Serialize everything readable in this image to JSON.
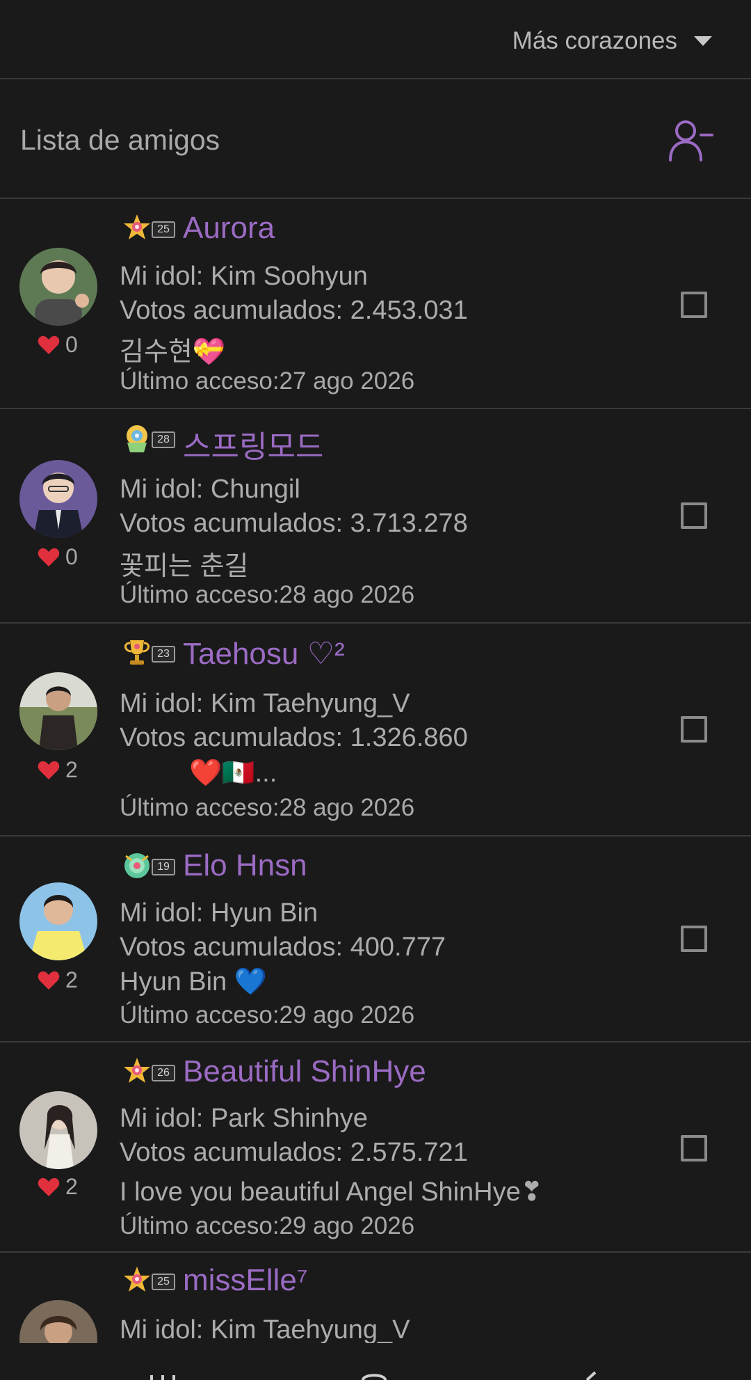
{
  "sort": {
    "label": "Más corazones"
  },
  "header": {
    "title": "Lista de amigos"
  },
  "friends": [
    {
      "level": "25",
      "nickname": "Aurora",
      "idol": "Mi idol: Kim Soohyun",
      "votes": "Votos acumulados: 2.453.031",
      "status": "김수현💝",
      "last_access": "Último acceso:27 ago 2026",
      "hearts": "0"
    },
    {
      "level": "28",
      "nickname": "스프링모드",
      "idol": "Mi idol: Chungil",
      "votes": "Votos acumulados: 3.713.278",
      "status": "꽃피는 춘길",
      "last_access": "Último acceso:28 ago 2026",
      "hearts": "0"
    },
    {
      "level": "23",
      "nickname": "Taehosu ♡²",
      "idol": "Mi idol: Kim Taehyung_V",
      "votes": "Votos acumulados: 1.326.860",
      "status": "❤️🇲🇽...",
      "last_access": "Último acceso:28 ago 2026",
      "hearts": "2"
    },
    {
      "level": "19",
      "nickname": "Elo Hnsn",
      "idol": "Mi idol: Hyun Bin",
      "votes": "Votos acumulados: 400.777",
      "status": "Hyun Bin 💙",
      "last_access": "Último acceso:29 ago 2026",
      "hearts": "2"
    },
    {
      "level": "26",
      "nickname": "Beautiful ShinHye",
      "idol": "Mi idol: Park Shinhye",
      "votes": "Votos acumulados: 2.575.721",
      "status": "I love you beautiful Angel ShinHye❣",
      "last_access": "Último acceso:29 ago 2026",
      "hearts": "2"
    },
    {
      "level": "25",
      "nickname": "missElle⁷",
      "idol": "Mi idol: Kim Taehyung_V"
    }
  ],
  "colors": {
    "background": "#1a1a1a",
    "nickname": "#9b6bc4",
    "heart": "#e0303d",
    "divider": "#3a3a3a"
  }
}
